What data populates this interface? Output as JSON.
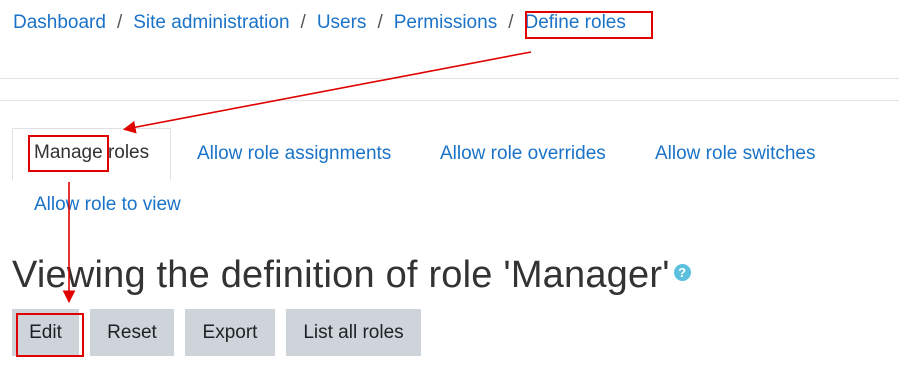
{
  "breadcrumb": {
    "items": [
      "Dashboard",
      "Site administration",
      "Users",
      "Permissions",
      "Define roles"
    ],
    "separator": "/"
  },
  "tabs": [
    {
      "label": "Manage roles",
      "active": true
    },
    {
      "label": "Allow role assignments",
      "active": false
    },
    {
      "label": "Allow role overrides",
      "active": false
    },
    {
      "label": "Allow role switches",
      "active": false
    },
    {
      "label": "Allow role to view",
      "active": false
    }
  ],
  "page": {
    "title": "Viewing the definition of role 'Manager'",
    "help_icon_glyph": "?"
  },
  "buttons": {
    "edit": "Edit",
    "reset": "Reset",
    "export": "Export",
    "list_all_roles": "List all roles"
  },
  "colors": {
    "link": "#1a73c8",
    "button_bg": "#ced4da",
    "annotation": "#e00000",
    "help_icon": "#5bc0de"
  }
}
